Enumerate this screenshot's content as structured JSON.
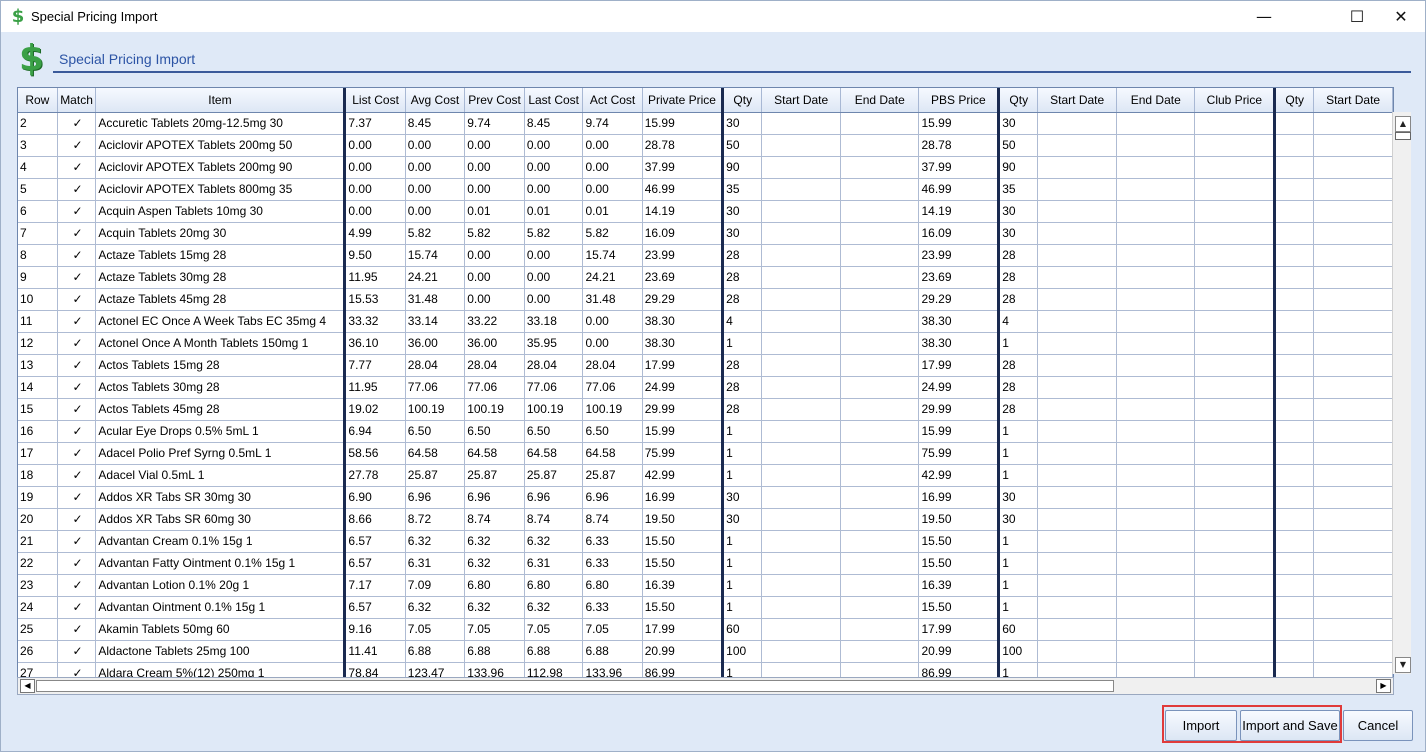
{
  "window": {
    "title": "Special Pricing Import",
    "minimize": "—",
    "maximize": "☐",
    "close": "✕"
  },
  "header": {
    "title": "Special Pricing Import",
    "icon": "dollar-icon"
  },
  "columns": [
    "Row",
    "Match",
    "Item",
    "List Cost",
    "Avg Cost",
    "Prev Cost",
    "Last Cost",
    "Act Cost",
    "Private Price",
    "Qty",
    "Start Date",
    "End Date",
    "PBS Price",
    "Qty",
    "Start Date",
    "End Date",
    "Club Price",
    "Qty",
    "Start Date"
  ],
  "rows": [
    [
      "2",
      "✓",
      "Accuretic Tablets 20mg-12.5mg 30",
      "7.37",
      "8.45",
      "9.74",
      "8.45",
      "9.74",
      "15.99",
      "30",
      "",
      "",
      "15.99",
      "30",
      "",
      "",
      "",
      "",
      ""
    ],
    [
      "3",
      "✓",
      "Aciclovir APOTEX Tablets 200mg 50",
      "0.00",
      "0.00",
      "0.00",
      "0.00",
      "0.00",
      "28.78",
      "50",
      "",
      "",
      "28.78",
      "50",
      "",
      "",
      "",
      "",
      ""
    ],
    [
      "4",
      "✓",
      "Aciclovir APOTEX Tablets 200mg 90",
      "0.00",
      "0.00",
      "0.00",
      "0.00",
      "0.00",
      "37.99",
      "90",
      "",
      "",
      "37.99",
      "90",
      "",
      "",
      "",
      "",
      ""
    ],
    [
      "5",
      "✓",
      "Aciclovir APOTEX Tablets 800mg 35",
      "0.00",
      "0.00",
      "0.00",
      "0.00",
      "0.00",
      "46.99",
      "35",
      "",
      "",
      "46.99",
      "35",
      "",
      "",
      "",
      "",
      ""
    ],
    [
      "6",
      "✓",
      "Acquin Aspen Tablets 10mg 30",
      "0.00",
      "0.00",
      "0.01",
      "0.01",
      "0.01",
      "14.19",
      "30",
      "",
      "",
      "14.19",
      "30",
      "",
      "",
      "",
      "",
      ""
    ],
    [
      "7",
      "✓",
      "Acquin Tablets 20mg 30",
      "4.99",
      "5.82",
      "5.82",
      "5.82",
      "5.82",
      "16.09",
      "30",
      "",
      "",
      "16.09",
      "30",
      "",
      "",
      "",
      "",
      ""
    ],
    [
      "8",
      "✓",
      "Actaze Tablets 15mg 28",
      "9.50",
      "15.74",
      "0.00",
      "0.00",
      "15.74",
      "23.99",
      "28",
      "",
      "",
      "23.99",
      "28",
      "",
      "",
      "",
      "",
      ""
    ],
    [
      "9",
      "✓",
      "Actaze Tablets 30mg 28",
      "11.95",
      "24.21",
      "0.00",
      "0.00",
      "24.21",
      "23.69",
      "28",
      "",
      "",
      "23.69",
      "28",
      "",
      "",
      "",
      "",
      ""
    ],
    [
      "10",
      "✓",
      "Actaze Tablets 45mg 28",
      "15.53",
      "31.48",
      "0.00",
      "0.00",
      "31.48",
      "29.29",
      "28",
      "",
      "",
      "29.29",
      "28",
      "",
      "",
      "",
      "",
      ""
    ],
    [
      "11",
      "✓",
      "Actonel EC Once A Week Tabs EC 35mg 4",
      "33.32",
      "33.14",
      "33.22",
      "33.18",
      "0.00",
      "38.30",
      "4",
      "",
      "",
      "38.30",
      "4",
      "",
      "",
      "",
      "",
      ""
    ],
    [
      "12",
      "✓",
      "Actonel Once A Month Tablets 150mg 1",
      "36.10",
      "36.00",
      "36.00",
      "35.95",
      "0.00",
      "38.30",
      "1",
      "",
      "",
      "38.30",
      "1",
      "",
      "",
      "",
      "",
      ""
    ],
    [
      "13",
      "✓",
      "Actos Tablets 15mg 28",
      "7.77",
      "28.04",
      "28.04",
      "28.04",
      "28.04",
      "17.99",
      "28",
      "",
      "",
      "17.99",
      "28",
      "",
      "",
      "",
      "",
      ""
    ],
    [
      "14",
      "✓",
      "Actos Tablets 30mg 28",
      "11.95",
      "77.06",
      "77.06",
      "77.06",
      "77.06",
      "24.99",
      "28",
      "",
      "",
      "24.99",
      "28",
      "",
      "",
      "",
      "",
      ""
    ],
    [
      "15",
      "✓",
      "Actos Tablets 45mg 28",
      "19.02",
      "100.19",
      "100.19",
      "100.19",
      "100.19",
      "29.99",
      "28",
      "",
      "",
      "29.99",
      "28",
      "",
      "",
      "",
      "",
      ""
    ],
    [
      "16",
      "✓",
      "Acular Eye Drops 0.5% 5mL 1",
      "6.94",
      "6.50",
      "6.50",
      "6.50",
      "6.50",
      "15.99",
      "1",
      "",
      "",
      "15.99",
      "1",
      "",
      "",
      "",
      "",
      ""
    ],
    [
      "17",
      "✓",
      "Adacel Polio Pref Syrng 0.5mL 1",
      "58.56",
      "64.58",
      "64.58",
      "64.58",
      "64.58",
      "75.99",
      "1",
      "",
      "",
      "75.99",
      "1",
      "",
      "",
      "",
      "",
      ""
    ],
    [
      "18",
      "✓",
      "Adacel Vial 0.5mL 1",
      "27.78",
      "25.87",
      "25.87",
      "25.87",
      "25.87",
      "42.99",
      "1",
      "",
      "",
      "42.99",
      "1",
      "",
      "",
      "",
      "",
      ""
    ],
    [
      "19",
      "✓",
      "Addos XR Tabs SR 30mg 30",
      "6.90",
      "6.96",
      "6.96",
      "6.96",
      "6.96",
      "16.99",
      "30",
      "",
      "",
      "16.99",
      "30",
      "",
      "",
      "",
      "",
      ""
    ],
    [
      "20",
      "✓",
      "Addos XR Tabs SR 60mg 30",
      "8.66",
      "8.72",
      "8.74",
      "8.74",
      "8.74",
      "19.50",
      "30",
      "",
      "",
      "19.50",
      "30",
      "",
      "",
      "",
      "",
      ""
    ],
    [
      "21",
      "✓",
      "Advantan Cream 0.1% 15g 1",
      "6.57",
      "6.32",
      "6.32",
      "6.32",
      "6.33",
      "15.50",
      "1",
      "",
      "",
      "15.50",
      "1",
      "",
      "",
      "",
      "",
      ""
    ],
    [
      "22",
      "✓",
      "Advantan Fatty Ointment 0.1% 15g 1",
      "6.57",
      "6.31",
      "6.32",
      "6.31",
      "6.33",
      "15.50",
      "1",
      "",
      "",
      "15.50",
      "1",
      "",
      "",
      "",
      "",
      ""
    ],
    [
      "23",
      "✓",
      "Advantan Lotion 0.1% 20g 1",
      "7.17",
      "7.09",
      "6.80",
      "6.80",
      "6.80",
      "16.39",
      "1",
      "",
      "",
      "16.39",
      "1",
      "",
      "",
      "",
      "",
      ""
    ],
    [
      "24",
      "✓",
      "Advantan Ointment 0.1% 15g 1",
      "6.57",
      "6.32",
      "6.32",
      "6.32",
      "6.33",
      "15.50",
      "1",
      "",
      "",
      "15.50",
      "1",
      "",
      "",
      "",
      "",
      ""
    ],
    [
      "25",
      "✓",
      "Akamin Tablets 50mg 60",
      "9.16",
      "7.05",
      "7.05",
      "7.05",
      "7.05",
      "17.99",
      "60",
      "",
      "",
      "17.99",
      "60",
      "",
      "",
      "",
      "",
      ""
    ],
    [
      "26",
      "✓",
      "Aldactone Tablets 25mg 100",
      "11.41",
      "6.88",
      "6.88",
      "6.88",
      "6.88",
      "20.99",
      "100",
      "",
      "",
      "20.99",
      "100",
      "",
      "",
      "",
      "",
      ""
    ],
    [
      "27",
      "✓",
      "Aldara Cream 5%(12) 250mg 1",
      "78.84",
      "123.47",
      "133.96",
      "112.98",
      "133.96",
      "86.99",
      "1",
      "",
      "",
      "86.99",
      "1",
      "",
      "",
      "",
      "",
      ""
    ]
  ],
  "buttons": {
    "import": "Import",
    "import_save": "Import and Save",
    "cancel": "Cancel"
  },
  "scroll": {
    "up": "▲",
    "down": "▼",
    "left": "◀",
    "right": "▶"
  },
  "colors": {
    "price_text": "#1b2ab3",
    "highlight": "#e03a3a",
    "header_title": "#2c54a5"
  }
}
